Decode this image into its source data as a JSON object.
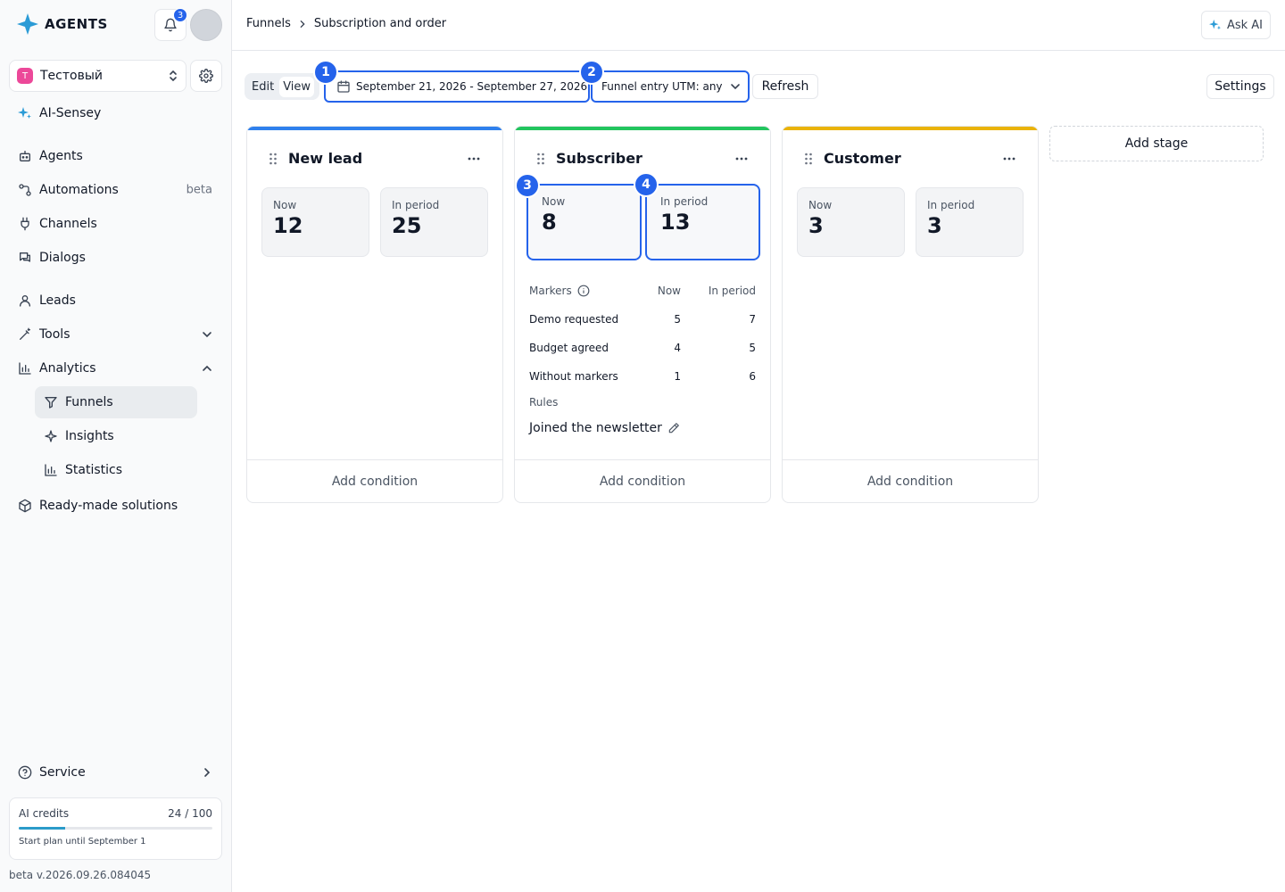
{
  "app": {
    "logo_text": "AGENTS",
    "notifications_count": "3",
    "workspace_initial": "T",
    "workspace_name": "Тестовый"
  },
  "sidebar": {
    "items": [
      {
        "label": "AI-Sensey"
      },
      {
        "label": "Agents"
      },
      {
        "label": "Automations",
        "badge": "beta"
      },
      {
        "label": "Channels"
      },
      {
        "label": "Dialogs"
      },
      {
        "label": "Leads"
      },
      {
        "label": "Tools"
      },
      {
        "label": "Analytics"
      }
    ],
    "analytics_sub": [
      {
        "label": "Funnels"
      },
      {
        "label": "Insights"
      },
      {
        "label": "Statistics"
      }
    ],
    "ready_made": "Ready-made solutions",
    "service": "Service",
    "credits": {
      "label": "AI credits",
      "value": "24 / 100",
      "used": 24,
      "total": 100,
      "plan": "Start plan until September 1"
    },
    "version": "beta v.2026.09.26.084045"
  },
  "header": {
    "breadcrumb": [
      "Funnels",
      "Subscription and order"
    ],
    "ask_ai": "Ask AI"
  },
  "toolbar": {
    "edit": "Edit",
    "view": "View",
    "date_range": "September 21, 2026 - September 27, 2026",
    "utm": "Funnel entry UTM: any",
    "refresh": "Refresh",
    "settings": "Settings"
  },
  "annotations": [
    "1",
    "2",
    "3",
    "4"
  ],
  "stages": [
    {
      "title": "New lead",
      "color": "#2f80ed",
      "now_label": "Now",
      "now": "12",
      "period_label": "In period",
      "period": "25",
      "footer": "Add condition"
    },
    {
      "title": "Subscriber",
      "color": "#22c55e",
      "now_label": "Now",
      "now": "8",
      "period_label": "In period",
      "period": "13",
      "markers_header": {
        "label": "Markers",
        "now": "Now",
        "period": "In period"
      },
      "markers": [
        {
          "name": "Demo requested",
          "now": "5",
          "period": "7"
        },
        {
          "name": "Budget agreed",
          "now": "4",
          "period": "5"
        },
        {
          "name": "Without markers",
          "now": "1",
          "period": "6"
        }
      ],
      "rules_label": "Rules",
      "rule": "Joined the newsletter",
      "footer": "Add condition"
    },
    {
      "title": "Customer",
      "color": "#eab308",
      "now_label": "Now",
      "now": "3",
      "period_label": "In period",
      "period": "3",
      "footer": "Add condition"
    }
  ],
  "add_stage": "Add stage"
}
